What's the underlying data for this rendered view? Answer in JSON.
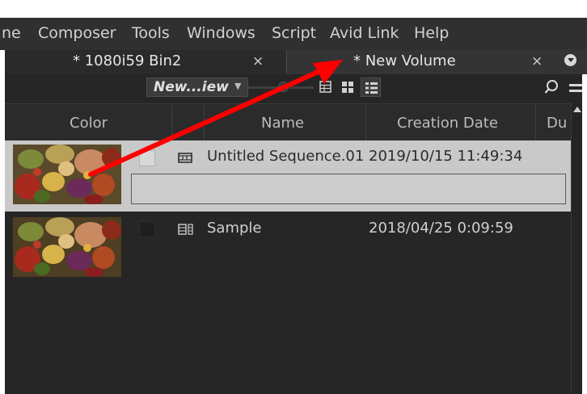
{
  "menubar": {
    "items": [
      "ne",
      "Composer",
      "Tools",
      "Windows",
      "Script",
      "Avid Link",
      "Help"
    ]
  },
  "tabs": [
    {
      "label": "* 1080i59 Bin2",
      "close": "×",
      "active": true
    },
    {
      "label": "* New Volume",
      "close": "×",
      "active": false
    }
  ],
  "toolbar": {
    "view_select": "New...iew",
    "view_select_caret": "▼"
  },
  "columns": {
    "color": "Color",
    "name": "Name",
    "creation_date": "Creation Date",
    "duration": "Du"
  },
  "rows": [
    {
      "name": "Untitled Sequence.01",
      "date": "2019/10/15 11:49:34",
      "type": "sequence",
      "selected": true
    },
    {
      "name": "Sample",
      "date": "2018/04/25 0:09:59",
      "type": "clip",
      "selected": false
    }
  ],
  "colors": {
    "annotation_arrow": "#ff0000",
    "panel_bg": "#262626",
    "selected_row": "#c9c9c9"
  },
  "icons": {
    "sequence": "film-sequence-icon",
    "clip": "film-clip-icon",
    "search": "search-icon",
    "fast_menu": "hamburger-icon",
    "tab_menu": "panel-menu-icon"
  }
}
